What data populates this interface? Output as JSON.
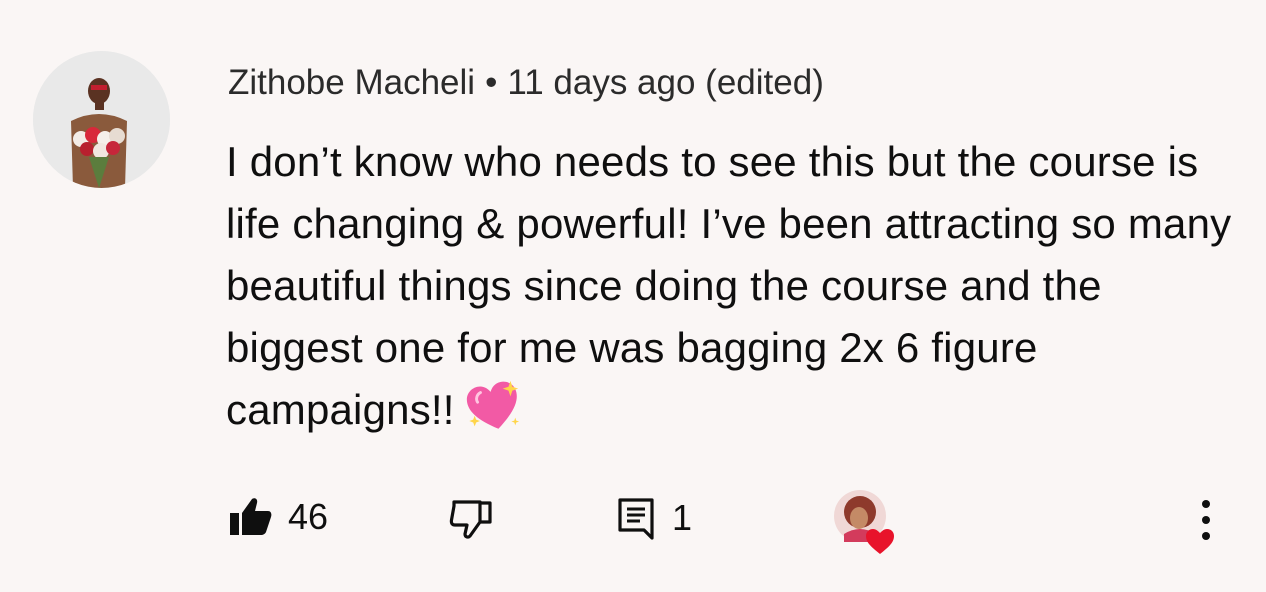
{
  "comment": {
    "author": "Zithobe Macheli",
    "separator": "•",
    "timestamp": "11 days ago (edited)",
    "text": "I don’t know who needs to see this but the course is life changing & powerful! I’ve been attracting so many beautiful things since doing the course and the biggest one for me was bagging 2x 6 figure campaigns!!",
    "emoji": "sparkling-heart-icon"
  },
  "actions": {
    "like_count": "46",
    "reply_count": "1",
    "like_icon": "thumbs-up-filled-icon",
    "dislike_icon": "thumbs-down-icon",
    "reply_icon": "comment-icon",
    "hearted_icon": "creator-heart-icon",
    "more_icon": "more-vertical-icon"
  },
  "colors": {
    "background": "#faf6f5",
    "text": "#0f0f0f",
    "heart": "#e8132b",
    "emoji_pink": "#f25aa5"
  }
}
